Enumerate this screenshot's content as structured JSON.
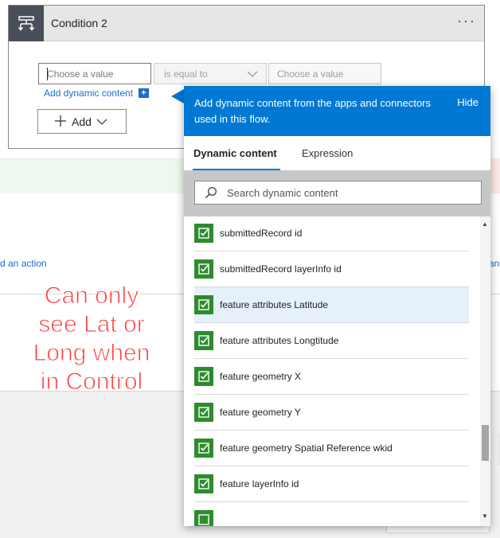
{
  "card": {
    "title": "Condition 2",
    "menu_glyph": "···",
    "icon": "condition-icon",
    "left_value_placeholder": "Choose a value",
    "operator": "is equal to",
    "right_value_placeholder": "Choose a value",
    "dynamic_link": "Add dynamic content",
    "dynamic_plus": "+",
    "add_button": "Add"
  },
  "background": {
    "add_action_link": "d an action",
    "right_edge_link": "an"
  },
  "annotation": {
    "text": "Can only see Lat or Long when in Control",
    "color": "#ff3b3b"
  },
  "flyout": {
    "description": "Add dynamic content from the apps and connectors used in this flow.",
    "hide_label": "Hide",
    "tabs": [
      "Dynamic content",
      "Expression"
    ],
    "active_tab": "Dynamic content",
    "search_placeholder": "Search dynamic content",
    "accent": "#0078d4",
    "items": [
      {
        "label": "submittedRecord id",
        "icon": "checklist-icon"
      },
      {
        "label": "submittedRecord layerInfo id",
        "icon": "checklist-icon"
      },
      {
        "label": "feature attributes Latitude",
        "icon": "checklist-icon",
        "selected": true
      },
      {
        "label": "feature attributes Longtitude",
        "icon": "checklist-icon"
      },
      {
        "label": "feature geometry X",
        "icon": "checklist-icon"
      },
      {
        "label": "feature geometry Y",
        "icon": "checklist-icon"
      },
      {
        "label": "feature geometry Spatial Reference wkid",
        "icon": "checklist-icon"
      },
      {
        "label": "feature layerInfo id",
        "icon": "checklist-icon"
      }
    ]
  }
}
